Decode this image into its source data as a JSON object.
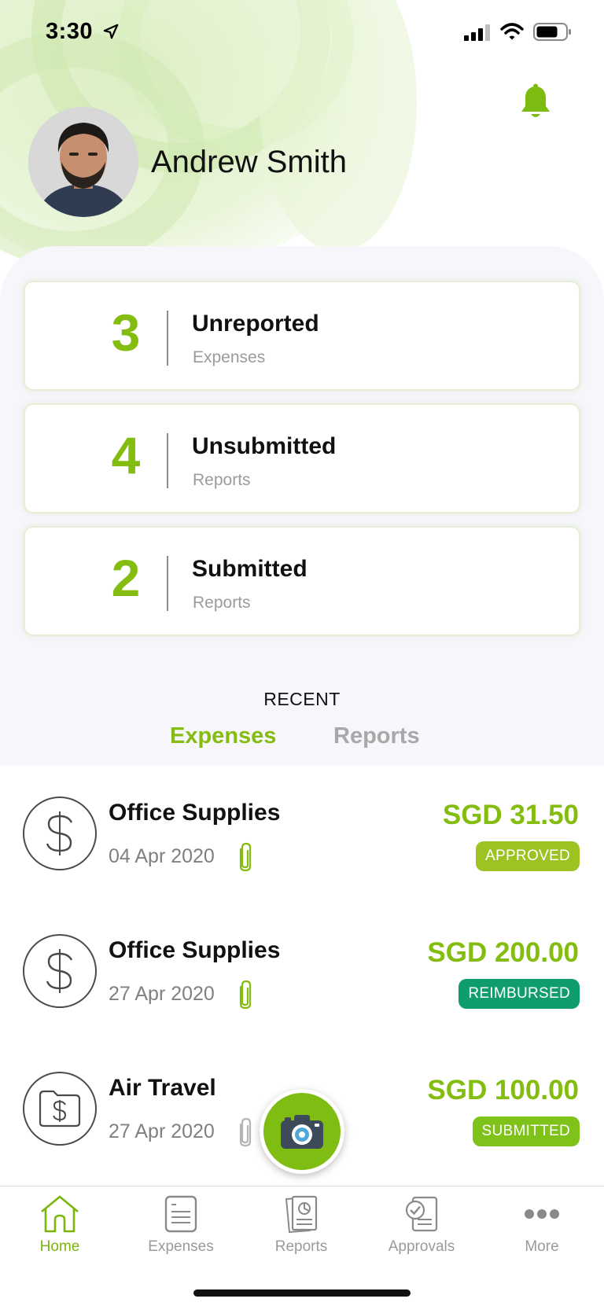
{
  "status_bar": {
    "time": "3:30"
  },
  "user": {
    "name": "Andrew Smith"
  },
  "stats": [
    {
      "count": "3",
      "title": "Unreported",
      "subtitle": "Expenses"
    },
    {
      "count": "4",
      "title": "Unsubmitted",
      "subtitle": "Reports"
    },
    {
      "count": "2",
      "title": "Submitted",
      "subtitle": "Reports"
    }
  ],
  "recent": {
    "heading": "RECENT",
    "tabs": [
      {
        "label": "Expenses",
        "active": true
      },
      {
        "label": "Reports",
        "active": false
      }
    ]
  },
  "expenses": [
    {
      "title": "Office Supplies",
      "date": "04 Apr 2020",
      "amount": "SGD 31.50",
      "status": "APPROVED",
      "icon": "dollar-icon",
      "attachment": true
    },
    {
      "title": "Office Supplies",
      "date": "27 Apr 2020",
      "amount": "SGD 200.00",
      "status": "REIMBURSED",
      "icon": "dollar-icon",
      "attachment": true
    },
    {
      "title": "Air Travel",
      "date": "27 Apr 2020",
      "amount": "SGD 100.00",
      "status": "SUBMITTED",
      "icon": "folder-dollar-icon",
      "attachment": true
    }
  ],
  "nav": [
    {
      "label": "Home",
      "icon": "home-icon",
      "active": true
    },
    {
      "label": "Expenses",
      "icon": "receipt-icon",
      "active": false
    },
    {
      "label": "Reports",
      "icon": "reports-icon",
      "active": false
    },
    {
      "label": "Approvals",
      "icon": "approvals-icon",
      "active": false
    },
    {
      "label": "More",
      "icon": "more-icon",
      "active": false
    }
  ],
  "colors": {
    "accent": "#84bd0f",
    "approved": "#9cc322",
    "reimbursed": "#0f9e6b",
    "submitted": "#7fc21a",
    "panel_bg": "#f6f6fb"
  }
}
